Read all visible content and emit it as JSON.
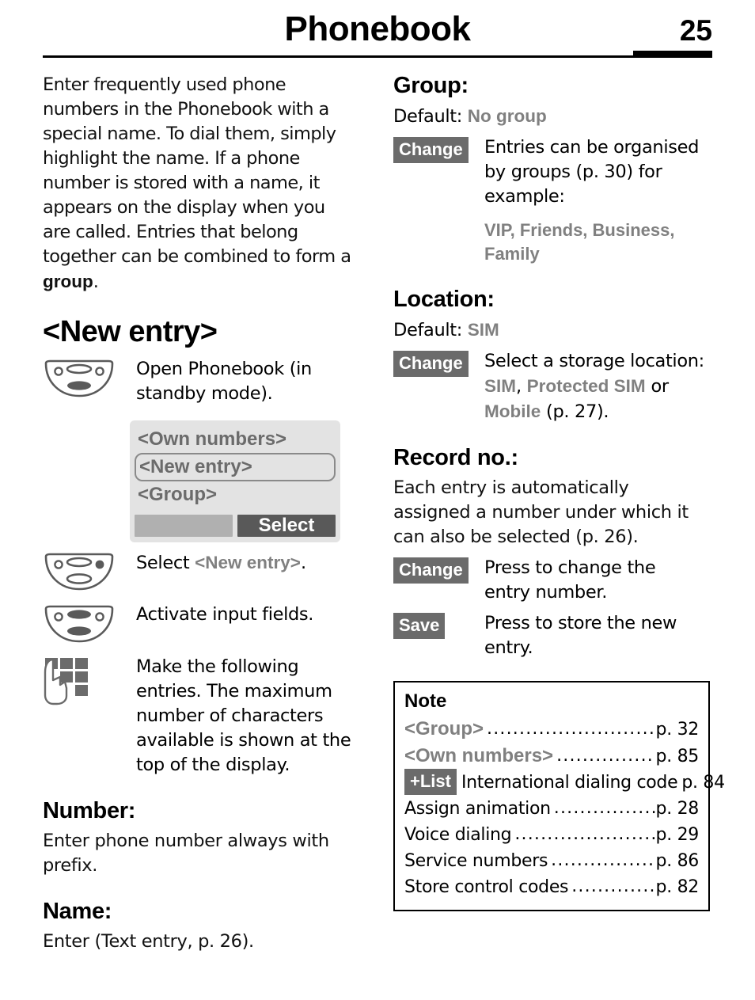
{
  "header": {
    "title": "Phonebook",
    "page_number": "25"
  },
  "left_column": {
    "intro_paragraph": "Enter frequently used phone numbers in the Phonebook with a special name. To dial them, simply highlight the name. If a phone number is stored with a name, it appears on the display when you are called. Entries that belong together can be combined to form a ",
    "intro_paragraph_bold": "group",
    "intro_paragraph_end": ".",
    "new_entry_heading": "<New entry>",
    "step_open": "Open Phonebook (in standby mode).",
    "phone_display": {
      "items": [
        "<Own numbers>",
        "<New entry>",
        "<Group>"
      ],
      "selected_index": 1,
      "softkey_left": "",
      "softkey_right": "Select"
    },
    "step_select_prefix": "Select ",
    "step_select_term": "<New entry>",
    "step_select_suffix": ".",
    "step_activate": "Activate input fields.",
    "step_make_entries": "Make the following entries. The maximum number of characters available is shown at the top of the display.",
    "number_heading": "Number:",
    "number_text": "Enter phone number always with prefix.",
    "name_heading": "Name:",
    "name_text": "Enter (Text entry, p. 26)."
  },
  "right_column": {
    "group": {
      "heading": "Group:",
      "default_label": "Default: ",
      "default_value": "No group",
      "change_button": "Change",
      "change_desc": "Entries can be organised by groups (p. 30) for example:",
      "examples": "VIP, Friends, Business, Family"
    },
    "location": {
      "heading": "Location:",
      "default_label": "Default: ",
      "default_value": "SIM",
      "change_button": "Change",
      "desc_prefix": "Select a storage location: ",
      "opt1": "SIM",
      "opt_sep1": ", ",
      "opt2": "Protected SIM",
      "opt_sep2": " or ",
      "opt3": "Mobile",
      "desc_suffix": " (p. 27)."
    },
    "record_no": {
      "heading": "Record no.:",
      "text": "Each entry is automatically assigned a number under which it can also be selected (p. 26).",
      "change_button": "Change",
      "change_desc": "Press to change the entry number.",
      "save_button": "Save",
      "save_desc": "Press to store the new entry."
    },
    "note": {
      "title": "Note",
      "lines": [
        {
          "label": "<Group>",
          "label_style": "gray",
          "page": "p. 32"
        },
        {
          "label": "<Own numbers>",
          "label_style": "gray",
          "page": "p. 85"
        },
        {
          "chip": "+List",
          "label": "International dialing code",
          "label_style": "plain",
          "page": "p. 84"
        },
        {
          "label": "Assign animation",
          "label_style": "plain",
          "page": "p. 28"
        },
        {
          "label": "Voice dialing",
          "label_style": "plain",
          "page": "p. 29"
        },
        {
          "label": "Service numbers",
          "label_style": "plain",
          "page": "p. 86"
        },
        {
          "label": "Store control codes",
          "label_style": "plain",
          "page": "p. 82"
        }
      ]
    }
  },
  "colors": {
    "ui_term_gray": "#808080",
    "chip_bg": "#6b6b6b",
    "display_bg": "#e3e3e3",
    "softkey_dark": "#595959",
    "softkey_light": "#b0b0b0"
  }
}
